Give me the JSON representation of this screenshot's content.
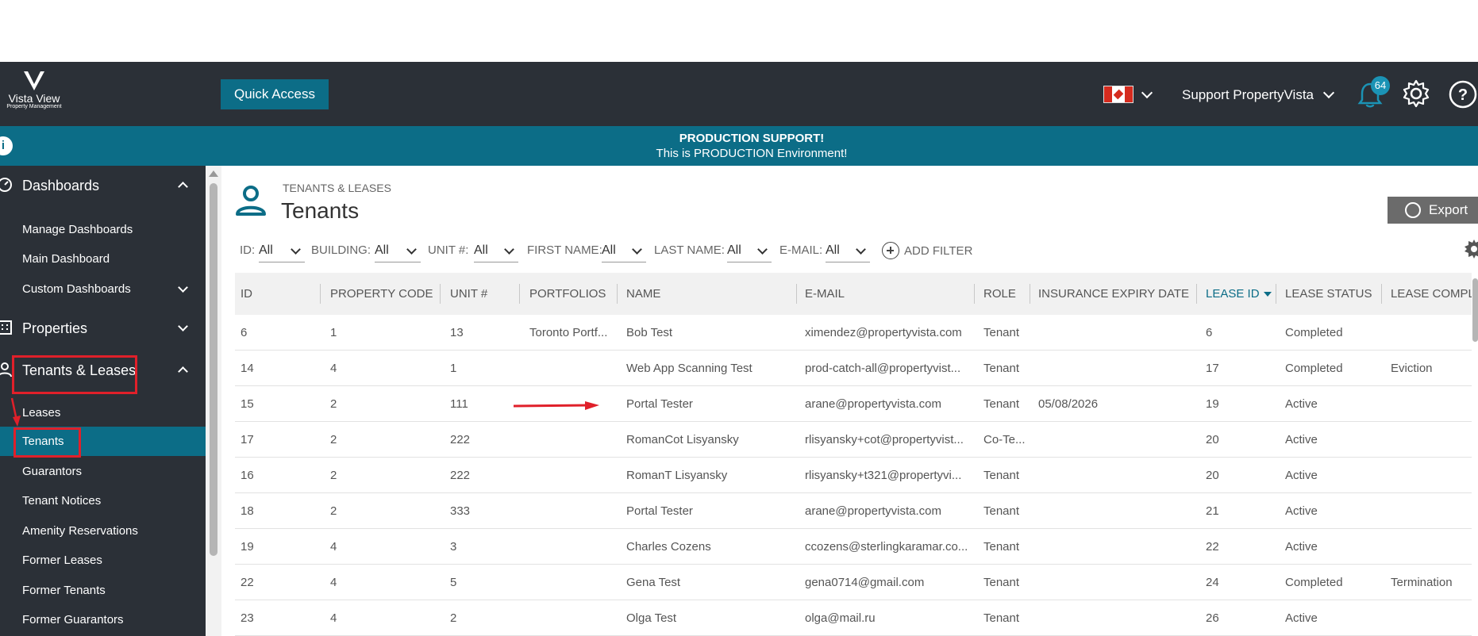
{
  "header": {
    "logo_name": "Vista View",
    "logo_sub": "Property Management",
    "quick_access": "Quick Access",
    "user_name": "Support PropertyVista",
    "notification_count": "64",
    "flag": "canada-flag"
  },
  "banner": {
    "title": "PRODUCTION SUPPORT!",
    "subtitle": "This is PRODUCTION Environment!",
    "info_icon": "i"
  },
  "sidebar": {
    "sections": [
      {
        "label": "Dashboards",
        "icon": "dashboard-icon",
        "expanded": true
      },
      {
        "label": "Properties",
        "icon": "building-icon",
        "expanded": false
      },
      {
        "label": "Tenants & Leases",
        "icon": "person-icon",
        "expanded": true
      }
    ],
    "dashboard_items": [
      "Manage Dashboards",
      "Main Dashboard",
      "Custom Dashboards"
    ],
    "tenant_items": [
      "Leases",
      "Tenants",
      "Guarantors",
      "Tenant Notices",
      "Amenity Reservations",
      "Former Leases",
      "Former Tenants",
      "Former Guarantors"
    ],
    "active_item": "Tenants"
  },
  "page": {
    "breadcrumb": "TENANTS & LEASES",
    "title": "Tenants",
    "export": "Export"
  },
  "filters": [
    {
      "label": "ID:",
      "value": "All"
    },
    {
      "label": "BUILDING:",
      "value": "All"
    },
    {
      "label": "UNIT #:",
      "value": "All"
    },
    {
      "label": "FIRST NAME:",
      "value": "All"
    },
    {
      "label": "LAST NAME:",
      "value": "All"
    },
    {
      "label": "E-MAIL:",
      "value": "All"
    }
  ],
  "add_filter": "ADD FILTER",
  "table": {
    "columns": [
      "ID",
      "PROPERTY CODE",
      "UNIT #",
      "PORTFOLIOS",
      "NAME",
      "E-MAIL",
      "ROLE",
      "INSURANCE EXPIRY DATE",
      "LEASE ID",
      "LEASE STATUS",
      "LEASE COMPL"
    ],
    "sorted_column": "LEASE ID",
    "rows": [
      [
        "6",
        "1",
        "13",
        "Toronto Portf...",
        "Bob Test",
        "ximendez@propertyvista.com",
        "Tenant",
        "",
        "6",
        "Completed",
        ""
      ],
      [
        "14",
        "4",
        "1",
        "",
        "Web App Scanning Test",
        "prod-catch-all@propertyvist...",
        "Tenant",
        "",
        "17",
        "Completed",
        "Eviction"
      ],
      [
        "15",
        "2",
        "111",
        "",
        "Portal Tester",
        "arane@propertyvista.com",
        "Tenant",
        "05/08/2026",
        "19",
        "Active",
        ""
      ],
      [
        "17",
        "2",
        "222",
        "",
        "RomanCot Lisyansky",
        "rlisyansky+cot@propertyvist...",
        "Co-Te...",
        "",
        "20",
        "Active",
        ""
      ],
      [
        "16",
        "2",
        "222",
        "",
        "RomanT Lisyansky",
        "rlisyansky+t321@propertyvi...",
        "Tenant",
        "",
        "20",
        "Active",
        ""
      ],
      [
        "18",
        "2",
        "333",
        "",
        "Portal Tester",
        "arane@propertyvista.com",
        "Tenant",
        "",
        "21",
        "Active",
        ""
      ],
      [
        "19",
        "4",
        "3",
        "",
        "Charles Cozens",
        "ccozens@sterlingkaramar.co...",
        "Tenant",
        "",
        "22",
        "Active",
        ""
      ],
      [
        "22",
        "4",
        "5",
        "",
        "Gena Test",
        "gena0714@gmail.com",
        "Tenant",
        "",
        "24",
        "Completed",
        "Termination"
      ],
      [
        "23",
        "4",
        "2",
        "",
        "Olga Test",
        "olga@mail.ru",
        "Tenant",
        "",
        "26",
        "Active",
        ""
      ]
    ]
  },
  "colors": {
    "dark": "#2b3037",
    "accent": "#0c6d87",
    "highlight": "#e0202a"
  }
}
